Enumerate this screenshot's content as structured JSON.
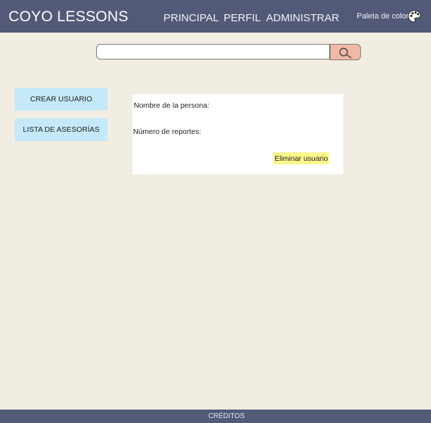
{
  "header": {
    "brand": "COYO LESSONS",
    "nav": [
      {
        "label": "PRINCIPAL"
      },
      {
        "label": "PERFIL"
      },
      {
        "label": "ADMINISTRAR"
      }
    ],
    "palette_label": "Paleta de color",
    "palette_icon": "palette-icon"
  },
  "search": {
    "value": "",
    "placeholder": "",
    "button_icon": "magnifier-icon"
  },
  "sidebar": {
    "buttons": [
      {
        "label": "CREAR USUARIO"
      },
      {
        "label": "LISTA DE ASESORÍAS"
      }
    ]
  },
  "user_card": {
    "name_label": "Nombre de la persona:",
    "reports_label": "Número de reportes:",
    "delete_label": "Eliminar usuario"
  },
  "footer": {
    "credits": "CRÉDITOS"
  },
  "colors": {
    "header_bg": "#525a78",
    "page_bg": "#f1ede2",
    "side_button_bg": "#c5e9f8",
    "search_button_bg": "#f0b9a6",
    "delete_button_bg": "#fbf88c"
  }
}
